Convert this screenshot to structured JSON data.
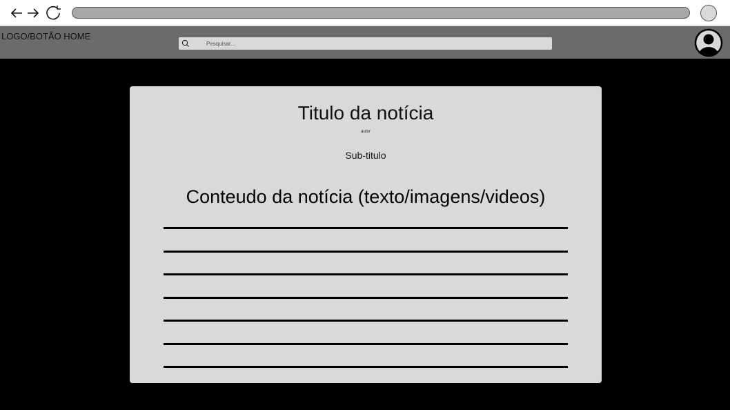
{
  "browser": {
    "icons": [
      "back-arrow-icon",
      "forward-arrow-icon",
      "reload-icon",
      "menu-circle-icon"
    ]
  },
  "header": {
    "logo_label": "LOGO/BOTÃO HOME",
    "search": {
      "placeholder": "Pesquisar...",
      "value": "",
      "icon": "search-icon"
    },
    "avatar_icon": "user-avatar-icon"
  },
  "article": {
    "title": "Titulo da notícia",
    "author": "autor",
    "subtitle": "Sub-titulo",
    "content_heading": "Conteudo da notícia (texto/imagens/videos)",
    "placeholder_line_count": 7
  },
  "colors": {
    "page_background": "#000000",
    "header_background": "#6b6b6b",
    "card_background": "#d9d9d9",
    "address_bar": "#a8a8a8"
  }
}
